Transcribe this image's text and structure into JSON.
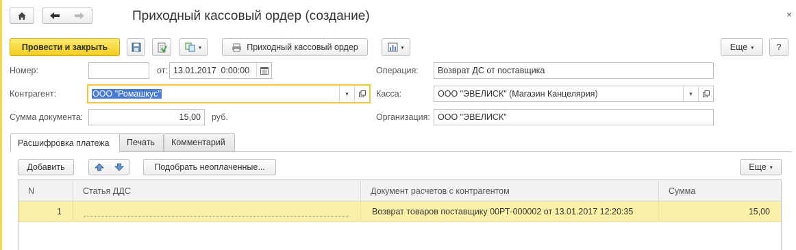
{
  "window": {
    "title": "Приходный кассовый ордер (создание)",
    "close_glyph": "×"
  },
  "toolbar": {
    "post_close_label": "Провести и закрыть",
    "print_label": "Приходный кассовый ордер",
    "more_label": "Еще",
    "help_label": "?"
  },
  "form": {
    "number_label": "Номер:",
    "number_value": "",
    "date_from_label": "от:",
    "date_value": "13.01.2017  0:00:00",
    "operation_label": "Операция:",
    "operation_value": "Возврат ДС от поставщика",
    "counterparty_label": "Контрагент:",
    "counterparty_value": "ООО \"Ромашкус\"",
    "cash_label": "Касса:",
    "cash_value": "ООО \"ЭВЕЛИСК\" (Магазин Канцелярия)",
    "sum_label": "Сумма документа:",
    "sum_value": "15,00",
    "currency": "руб.",
    "org_label": "Организация:",
    "org_value": "ООО \"ЭВЕЛИСК\""
  },
  "tabs": [
    {
      "label": "Расшифровка платежа",
      "active": true
    },
    {
      "label": "Печать",
      "active": false
    },
    {
      "label": "Комментарий",
      "active": false
    }
  ],
  "table_toolbar": {
    "add_label": "Добавить",
    "pick_label": "Подобрать неоплаченные...",
    "more_label": "Еще"
  },
  "table": {
    "columns": [
      "N",
      "Статья ДДС",
      "Документ расчетов с контрагентом",
      "Сумма"
    ],
    "rows": [
      {
        "n": "1",
        "article": "",
        "document": "Возврат товаров поставщику 00РТ-000002 от 13.01.2017 12:20:35",
        "sum": "15,00"
      }
    ]
  },
  "colors": {
    "accent_yellow": "#f2cd1f",
    "selected_row": "#fbf0a8",
    "focus_border": "#f0c838",
    "selection_blue": "#4a7bd2"
  },
  "icons": [
    "home-icon",
    "back-arrow-icon",
    "forward-arrow-icon",
    "save-icon",
    "post-icon",
    "create-based-on-icon",
    "printer-icon",
    "report-icon",
    "calendar-icon",
    "dropdown-icon",
    "open-icon",
    "move-up-icon",
    "move-down-icon",
    "close-icon"
  ]
}
